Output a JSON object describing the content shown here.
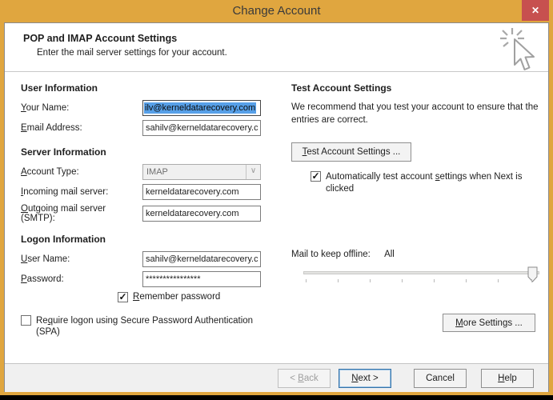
{
  "titlebar": {
    "title": "Change Account"
  },
  "header": {
    "title": "POP and IMAP Account Settings",
    "subtitle": "Enter the mail server settings for your account."
  },
  "user_info": {
    "heading": "User Information",
    "your_name": {
      "label": {
        "pre": "",
        "u": "Y",
        "post": "our Name:"
      },
      "value": "ilv@kerneldatarecovery.com"
    },
    "email": {
      "label": {
        "pre": "",
        "u": "E",
        "post": "mail Address:"
      },
      "value": "sahilv@kerneldatarecovery.c"
    }
  },
  "server_info": {
    "heading": "Server Information",
    "account_type": {
      "label": {
        "pre": "",
        "u": "A",
        "post": "ccount Type:"
      },
      "value": "IMAP"
    },
    "incoming": {
      "label": {
        "pre": "",
        "u": "I",
        "post": "ncoming mail server:"
      },
      "value": "kerneldatarecovery.com"
    },
    "outgoing": {
      "label": {
        "pre": "",
        "u": "O",
        "post": "utgoing mail server (SMTP):"
      },
      "value": "kerneldatarecovery.com"
    }
  },
  "logon_info": {
    "heading": "Logon Information",
    "user_name": {
      "label": {
        "pre": "",
        "u": "U",
        "post": "ser Name:"
      },
      "value": "sahilv@kerneldatarecovery.c"
    },
    "password": {
      "label": {
        "pre": "",
        "u": "P",
        "post": "assword:"
      },
      "value": "****************"
    },
    "remember": {
      "label": {
        "pre": "",
        "u": "R",
        "post": "emember password"
      },
      "checked": true
    },
    "spa": {
      "label": {
        "pre": "Re",
        "u": "q",
        "post": "uire logon using Secure Password Authentication (SPA)"
      },
      "checked": false
    }
  },
  "test_settings": {
    "heading": "Test Account Settings",
    "description": "We recommend that you test your account to ensure that the entries are correct.",
    "test_button": {
      "label": {
        "pre": "",
        "u": "T",
        "post": "est Account Settings ..."
      }
    },
    "autotest": {
      "label": {
        "pre": "Automatically test account ",
        "u": "s",
        "post": "ettings when Next is clicked"
      },
      "checked": true
    }
  },
  "offline": {
    "label": "Mail to keep offline:",
    "value": "All",
    "slider_position": "max"
  },
  "more_settings_button": {
    "label": {
      "pre": "",
      "u": "M",
      "post": "ore Settings ..."
    }
  },
  "footer": {
    "back": {
      "label": {
        "pre": "< ",
        "u": "B",
        "post": "ack"
      },
      "enabled": false
    },
    "next": {
      "label": {
        "pre": "",
        "u": "N",
        "post": "ext >"
      },
      "enabled": true
    },
    "cancel": {
      "label": "Cancel"
    },
    "help": {
      "label": {
        "pre": "",
        "u": "H",
        "post": "elp"
      }
    }
  },
  "glyphs": {
    "close": "✕",
    "check": "✓",
    "chevron": "∨"
  },
  "colors": {
    "titlebar_gold": "#E0A63F",
    "close_red": "#C7504F",
    "selection_blue": "#57A0E8"
  }
}
